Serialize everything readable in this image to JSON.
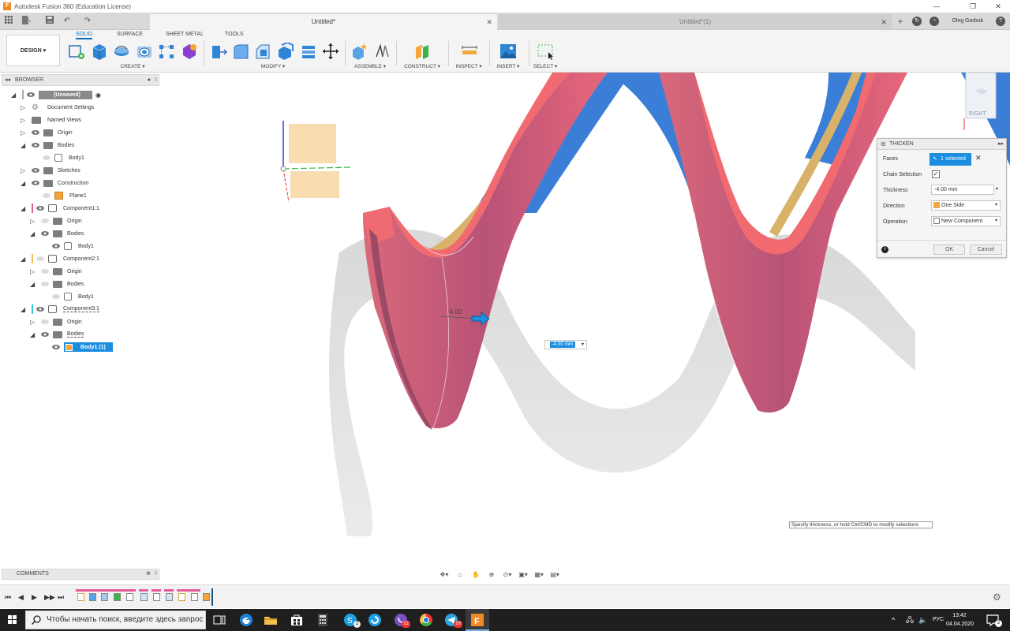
{
  "window": {
    "title": "Autodesk Fusion 360 (Education License)",
    "logo_letter": "F",
    "minimize": "—",
    "restore": "❐",
    "close": "✕"
  },
  "tabs": {
    "items": [
      {
        "label": "Untitled*",
        "active": true
      },
      {
        "label": "Untitled*(1)",
        "active": false
      }
    ],
    "close_glyph": "✕",
    "new_tab_glyph": "+",
    "user_name": "Oleg Garbuk"
  },
  "toolbar": {
    "workspace_button": "DESIGN",
    "workspace_caret": "▾",
    "workspace_tabs": [
      "SOLID",
      "SURFACE",
      "SHEET METAL",
      "TOOLS"
    ],
    "active_workspace_tab": "SOLID",
    "groups": {
      "create": "CREATE ▾",
      "modify": "MODIFY ▾",
      "assemble": "ASSEMBLE ▾",
      "construct": "CONSTRUCT ▾",
      "inspect": "INSPECT ▾",
      "insert": "INSERT ▾",
      "select": "SELECT ▾"
    }
  },
  "browser": {
    "title": "BROWSER",
    "collapse_glyph": "◂◂",
    "rows": [
      {
        "label": "(Unsaved)"
      },
      {
        "label": "Document Settings"
      },
      {
        "label": "Named Views"
      },
      {
        "label": "Origin"
      },
      {
        "label": "Bodies"
      },
      {
        "label": "Body1"
      },
      {
        "label": "Sketches"
      },
      {
        "label": "Construction"
      },
      {
        "label": "Plane1"
      },
      {
        "label": "Component1:1"
      },
      {
        "label": "Origin"
      },
      {
        "label": "Bodies"
      },
      {
        "label": "Body1"
      },
      {
        "label": "Component2:1"
      },
      {
        "label": "Origin"
      },
      {
        "label": "Bodies"
      },
      {
        "label": "Body1"
      },
      {
        "label": "Component3:1"
      },
      {
        "label": "Origin"
      },
      {
        "label": "Bodies"
      },
      {
        "label": "Body1 (1)"
      }
    ],
    "component_colors": [
      "#e85a9a",
      "#f2c14e",
      "#3cc7d6"
    ]
  },
  "comments": {
    "title": "COMMENTS"
  },
  "thicken": {
    "title": "THICKEN",
    "expand_glyph": "▸▸",
    "faces_label": "Faces",
    "faces_value": "1 selected",
    "clear_glyph": "✕",
    "chain_label": "Chain Selection",
    "chain_checked": "✓",
    "thickness_label": "Thickness",
    "thickness_value": "-4.00 mm",
    "direction_label": "Direction",
    "direction_value": "One Side",
    "operation_label": "Operation",
    "operation_value": "New Component",
    "ok": "OK",
    "cancel": "Cancel",
    "info_glyph": "i"
  },
  "viewport": {
    "dimension_label": "-4.00",
    "inline_input_value": "-4.00 mm",
    "hint": "Specify thickness, or hold Ctrl/CMD to modify selections",
    "viewcube_label": "RIGHT",
    "body_colors": {
      "red": "#e8545a",
      "blue": "#3b7ed8",
      "tan": "#d9b26a"
    }
  },
  "timeline": {
    "controls": [
      "⏮",
      "◀",
      "▶",
      "▶▶",
      "⏭"
    ]
  },
  "taskbar": {
    "search_placeholder": "Чтобы начать поиск, введите здесь запрос",
    "language": "РУС",
    "time": "13:42",
    "date": "04.04.2020",
    "notification_count": "2",
    "badge_skype": "2",
    "badge_viber": "12",
    "badge_telegram": "18"
  }
}
